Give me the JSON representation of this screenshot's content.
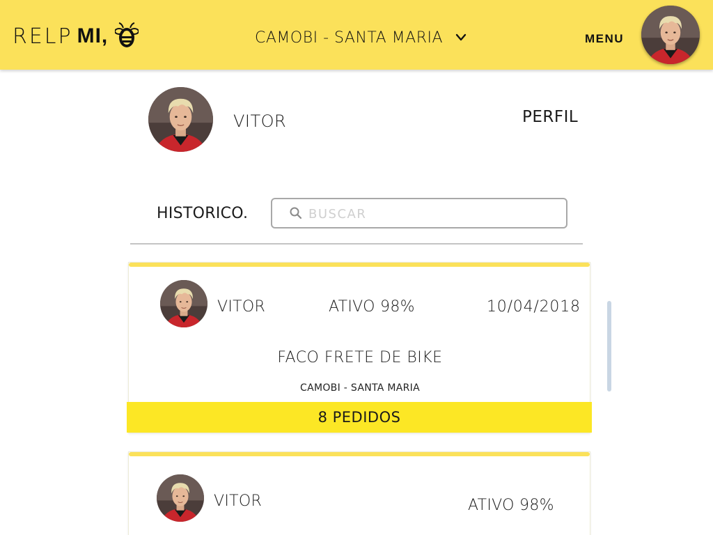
{
  "header": {
    "logo_left": "RELP",
    "logo_right": "MI,",
    "location": "CAMOBI - SANTA MARIA",
    "menu_label": "MENU"
  },
  "profile": {
    "name": "VITOR",
    "profile_link": "PERFIL"
  },
  "history": {
    "label": "HISTORICO.",
    "search_placeholder": "BUSCAR"
  },
  "cards": [
    {
      "name": "VITOR",
      "status": "ATIVO 98%",
      "date": "10/04/2018",
      "title": "FACO FRETE DE BIKE",
      "location": "CAMOBI - SANTA MARIA",
      "orders": "8 PEDIDOS"
    },
    {
      "name": "VITOR",
      "status": "ATIVO 98%"
    }
  ],
  "colors": {
    "header_bg": "#fbe15a",
    "orders_bg": "#fce725",
    "scrollbar": "#c9d6e4"
  },
  "icons": [
    "bee-icon",
    "chevron-down-icon",
    "search-icon",
    "avatar"
  ]
}
